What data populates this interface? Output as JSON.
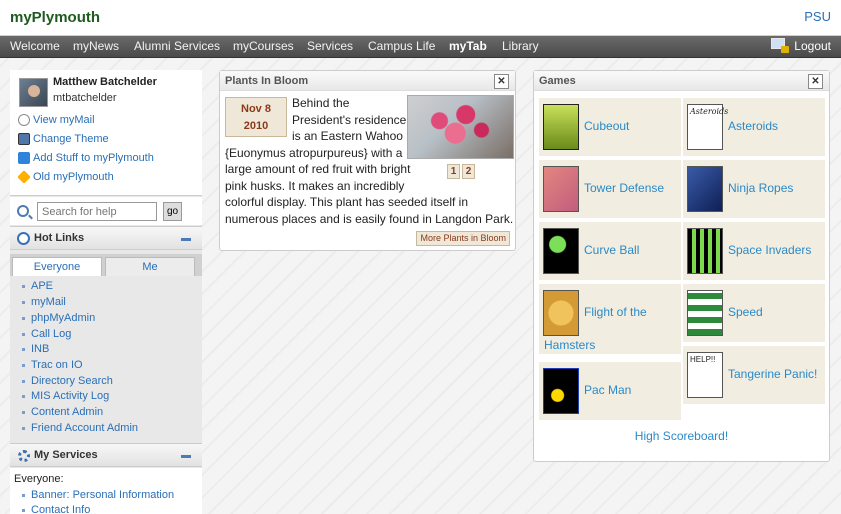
{
  "header": {
    "brand": "myPlymouth",
    "psu": "PSU"
  },
  "nav": {
    "items": [
      "Welcome",
      "myNews",
      "Alumni Services",
      "myCourses",
      "Services",
      "Campus Life",
      "myTab",
      "Library"
    ],
    "logout": "Logout"
  },
  "profile": {
    "name": "Matthew Batchelder",
    "username": "mtbatchelder",
    "links": [
      "View myMail",
      "Change Theme",
      "Add Stuff to myPlymouth",
      "Old myPlymouth"
    ]
  },
  "search": {
    "placeholder": "Search for help",
    "go": "go"
  },
  "hot_links": {
    "title": "Hot Links",
    "tabs": [
      "Everyone",
      "Me"
    ],
    "items": [
      "APE",
      "myMail",
      "phpMyAdmin",
      "Call Log",
      "INB",
      "Trac on IO",
      "Directory Search",
      "MIS Activity Log",
      "Content Admin",
      "Friend Account Admin"
    ]
  },
  "my_services": {
    "title": "My Services",
    "group": "Everyone:",
    "items": [
      "Banner: Personal Information",
      "Contact Info"
    ]
  },
  "plants": {
    "title": "Plants In Bloom",
    "date_month": "Nov 8",
    "date_year": "2010",
    "lines": [
      "Behind the",
      "President's residence",
      "is an Eastern Wahoo",
      "{Euonymus atropurpureus} with a",
      "large amount of red fruit with bright",
      "pink husks. It makes an incredibly",
      "colorful display. This plant has seeded itself in",
      "numerous places and is easily found in Langdon Park."
    ],
    "pages": [
      "1",
      "2"
    ],
    "more": "More Plants in Bloom"
  },
  "games": {
    "title": "Games",
    "left": [
      "Cubeout",
      "Tower Defense",
      "Curve Ball",
      "Flight of the",
      "Pac Man"
    ],
    "left_wrap": "Hamsters",
    "right": [
      "Asteroids",
      "Ninja Ropes",
      "Space Invaders",
      "Speed",
      "Tangerine Panic!"
    ],
    "thumb_labels": {
      "asteroids": "Asteroids",
      "tangerine": "HELP!!"
    },
    "high_score": "High Scoreboard!"
  },
  "colors": {
    "link": "#2a6fb6",
    "game_link": "#2a8ac8",
    "nav_bg": "#555555",
    "brand": "#1f5a1f"
  },
  "icons": [
    "search-icon",
    "close-icon",
    "gear-icon",
    "lock-icon",
    "collapse-icon"
  ]
}
